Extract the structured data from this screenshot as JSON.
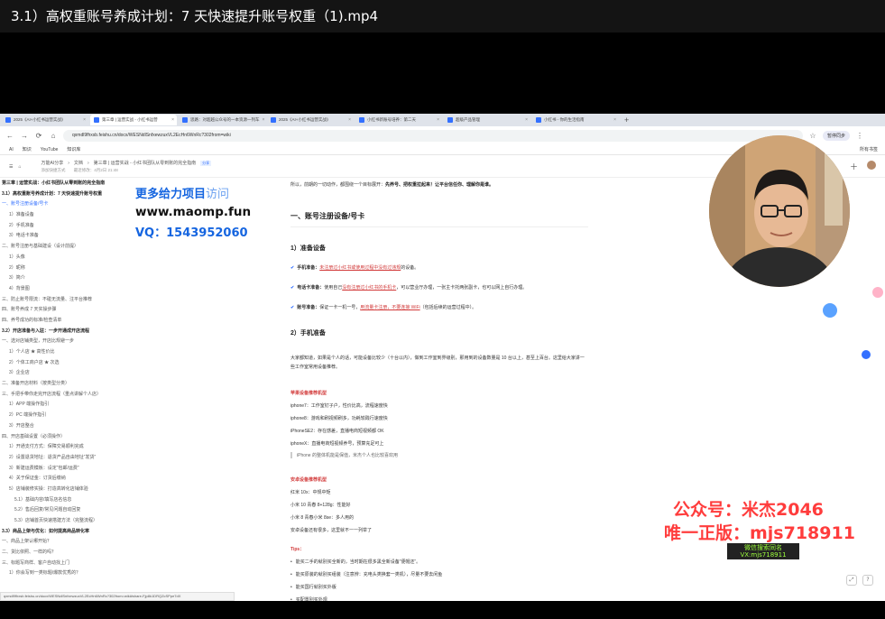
{
  "player": {
    "title": "3.1）高权重账号养成计划：7 天快速提升账号权重（1).mp4"
  },
  "browser": {
    "tabs": [
      {
        "label": "2025《AI+小红书运营实战》",
        "active": false
      },
      {
        "label": "第三章 | 运营实战 - 小红书运营",
        "active": true
      },
      {
        "label": "思路：对超越公众号的一本资源一列车",
        "active": false
      },
      {
        "label": "2025《AI+小红书运营实战》",
        "active": false
      },
      {
        "label": "小红书新账号培养：第二天",
        "active": false
      },
      {
        "label": "超级产品管理",
        "active": false
      },
      {
        "label": "小红书 - 你的生活指南",
        "active": false
      }
    ],
    "newtab": "+",
    "url": "qxmdl9fhxsb.feishu.cn/docx/WESNdlSnfxewzuxVL2EcHn6WnRc?302from=wiki",
    "profile": "暂停同步",
    "bookmarks": [
      "AI",
      "知识",
      "YouTube",
      "知识库"
    ],
    "bookmarks_right": "所有书签"
  },
  "doc": {
    "breadcrumb": [
      "万能AI分享",
      "文档",
      "第三章 | 运营实战 - 小红书团队从零到账的完全指南"
    ],
    "tag": "分享",
    "meta_left": "添加快捷方式",
    "meta_right": "最近修改：4月2日 21:48",
    "toc": [
      {
        "text": "第三章 | 运营实战：小红书团队从零到账的完全指南",
        "level": "h1"
      },
      {
        "text": "3.1）高权重账号养成计划：7 天快速提升账号权重",
        "level": "h1"
      },
      {
        "text": "一、账号注册设备/号卡",
        "level": "h2",
        "active": true
      },
      {
        "text": "1）准备设备",
        "level": "h3"
      },
      {
        "text": "2）手机准备",
        "level": "h3"
      },
      {
        "text": "3）电话卡准备",
        "level": "h3"
      },
      {
        "text": "二、账号注册与基础建设（设计前提）",
        "level": "h2"
      },
      {
        "text": "1）头像",
        "level": "h3"
      },
      {
        "text": "2）昵称",
        "level": "h3"
      },
      {
        "text": "3）简介",
        "level": "h3"
      },
      {
        "text": "4）背景图",
        "level": "h3"
      },
      {
        "text": "三、防止账号限流：不碰无流量、注平台推荐",
        "level": "h2"
      },
      {
        "text": "四、账号养成 7 天实操步骤",
        "level": "h2"
      },
      {
        "text": "四、养号成功的标准/检查清单",
        "level": "h2"
      },
      {
        "text": "3.2）开店准备与入驻：一步开通成开店流程",
        "level": "h1"
      },
      {
        "text": "一、选对店铺类型，开店比规避一步",
        "level": "h2"
      },
      {
        "text": "1）个人店 ★ 高性价比",
        "level": "h3"
      },
      {
        "text": "2）个体工商户店 ★ 次选",
        "level": "h3"
      },
      {
        "text": "3）企业店",
        "level": "h3"
      },
      {
        "text": "二、准备开店材料（按类型分类）",
        "level": "h2"
      },
      {
        "text": "三、手把手带你走完开店流程（重点讲解个人店）",
        "level": "h2"
      },
      {
        "text": "1）APP 端操作指引",
        "level": "h3"
      },
      {
        "text": "2）PC 端操作指引",
        "level": "h3"
      },
      {
        "text": "3）开店整合",
        "level": "h3"
      },
      {
        "text": "四、开店基础设置（必须操作）",
        "level": "h2"
      },
      {
        "text": "1）开通支付方式：保障交易顺利完成",
        "level": "h3"
      },
      {
        "text": "2）设置退货地址：退货产品自由地址“发货”",
        "level": "h3"
      },
      {
        "text": "3）新建运费模板：设定“包邮/运费”",
        "level": "h3"
      },
      {
        "text": "4）关于保证金：订货后缴纳",
        "level": "h3"
      },
      {
        "text": "5）店铺装修实操：打造高转化店铺体验",
        "level": "h3"
      },
      {
        "text": "5.1）基础内容/填写店名信息",
        "level": "h4"
      },
      {
        "text": "5.2）售后回复/常见问题自动回复",
        "level": "h4"
      },
      {
        "text": "5.3）店铺首页快速搭建方法（完整流程）",
        "level": "h4"
      },
      {
        "text": "3.3）商品上架与优化：如何提高商品转化率",
        "level": "h1"
      },
      {
        "text": "一、商品上架认哪开始？",
        "level": "h2"
      },
      {
        "text": "二、货比依照、一样的吗？",
        "level": "h2"
      },
      {
        "text": "三、标题写商样、客户自动找上门",
        "level": "h2"
      },
      {
        "text": "1）你会写到一类标题/爆款优秀的？",
        "level": "h3"
      }
    ],
    "status_url": "qxmdl9fhxsb.feishu.cn/docx/WESNdlSnfxewzuxVL2EcHn6WnRc?302from=wiki#share-Fjp8k1DRQZcSPpe7dX"
  },
  "article": {
    "intro_plain": "所以，前期的一切动作，都围绕一个目标展开：",
    "intro_bold": "先养号、把权重拉起来！让平台信任你、理解你是谁。",
    "h2": "一、账号注册设备/号卡",
    "h3_1": "1）准备设备",
    "checks": [
      {
        "label": "手机准备：",
        "pre": "",
        "u": "未注册过小红书或使用过程中没有过违规",
        "post": "的设备。"
      },
      {
        "label": "电话卡准备：",
        "pre": "使用自己",
        "u": "没有注册过小红书的手机卡",
        "post": "，可以营业厅办理，一张主卡托两张副卡，也可以网上自行办理。"
      },
      {
        "label": "账号准备：",
        "pre": "保证一卡一机一号，",
        "u": "用流量卡注册，不要连接 WiFi",
        "post": "（包括后续的运营过程中）。"
      }
    ],
    "h3_2": "2）手机准备",
    "para": "大家都知道，如果是个人的话，可能设备比较少（十台以内），做到工作室到界级别，那用到的设备数量是 10 台以上，甚至上百台。这里给大家讲一些工作室常用设备推荐。",
    "apple_head": "苹果设备推荐机型",
    "apple_items": [
      "iphone7：工作室钉子户，性价比高，流程速度快",
      "iphone8：游戏和刷视频刷多，功耗较践行速度快",
      "iPhoneSE2：存在感差，直播电商短视频都 OK",
      "iphoneX：直播电商短视频养号，预算充足可上"
    ],
    "apple_quote": "iPhone 的整体机能是保值，米杰个人也比较喜欢用",
    "android_head": "安卓设备推荐机型",
    "android_items": [
      "红米 10x：中规中矩",
      "小米 10 青春 8+128g：性能好",
      "小米 8 青春小米 8se：多人用的",
      "安卓设备还有很多，这里就不一一列举了"
    ],
    "tips_head": "Tips：",
    "tips": [
      "能买二手的就别买全新的，当时期在很多黑全新设备“便帽还”。",
      "能买原装的就别买组装（注意辨：充电头类换套一类机），尽量不要去闲鱼",
      "能买国行就别买外版",
      "买配置别买外观",
      "工具链在别买外"
    ]
  },
  "watermarks": {
    "line1": "更多给力项目",
    "line1_light": "访问",
    "line2": "www.maomp.fun",
    "line3": "VQ：1543952060",
    "pub1": "公众号：米杰2046",
    "pub2": "唯一正版：mjs718911",
    "green1": "微信搜索同名",
    "green2": "VX:mjs718911"
  },
  "colors": {
    "accent": "#3370ff",
    "link_red": "#d23b3b",
    "wm_red": "#ff3c3c",
    "wm_blue": "#1565e0"
  }
}
